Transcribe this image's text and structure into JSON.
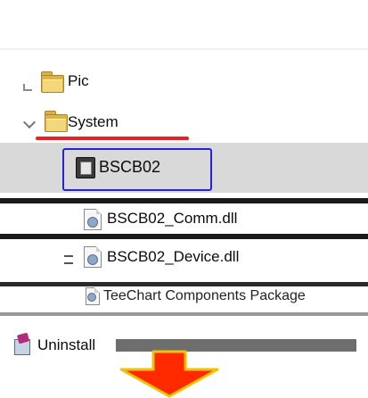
{
  "tree": {
    "items": [
      {
        "label": "Pic",
        "icon": "folder-icon"
      },
      {
        "label": "System",
        "icon": "folder-icon"
      },
      {
        "label": "BSCB02",
        "icon": "application-icon"
      },
      {
        "label": "BSCB02_Comm.dll",
        "icon": "dll-file-icon"
      },
      {
        "label": "BSCB02_Device.dll",
        "icon": "dll-file-icon"
      },
      {
        "label": "TeeChart Components Package",
        "icon": "package-file-icon"
      },
      {
        "label": "Uninstall",
        "icon": "uninstall-icon"
      }
    ]
  },
  "colors": {
    "selection_highlight": "#d9d9d9",
    "focus_box": "#2424d4",
    "underline_accent": "#e2232a",
    "arrow_fill": "#ff2a00",
    "arrow_stroke": "#f2c200"
  }
}
